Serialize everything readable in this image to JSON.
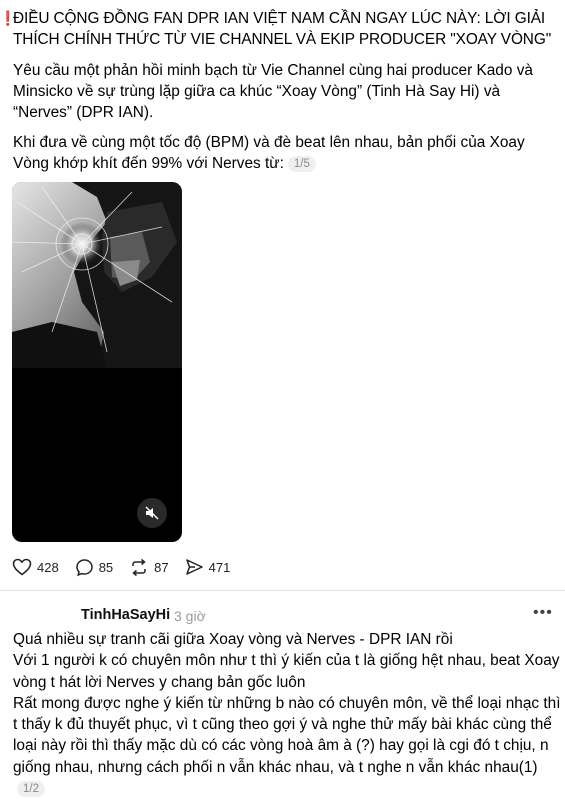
{
  "post": {
    "lead_icon": "❗",
    "title": "ĐIỀU CỘNG ĐỒNG FAN DPR IAN VIỆT NAM CẦN NGAY LÚC NÀY: LỜI GIẢI THÍCH CHÍNH THỨC TỪ VIE CHANNEL VÀ EKIP PRODUCER \"XOAY VÒNG\"",
    "para1": "Yêu cầu một phản hồi minh bạch từ Vie Channel cùng hai producer Kado và Minsicko về sự trùng lặp giữa ca khúc “Xoay Vòng” (Tinh Hà Say Hi) và “Nerves” (DPR IAN).",
    "para2": "Khi đưa về cùng một tốc độ (BPM) và đè beat lên nhau, bản phối của Xoay Vòng khớp khít đến 99% với Nerves từ:",
    "pager": "1/5",
    "media": {
      "mute_icon": "speaker-muted-icon"
    },
    "actions": {
      "likes": "428",
      "comments": "85",
      "reposts": "87",
      "shares": "471"
    }
  },
  "reply": {
    "username": "TinhHaSayHi",
    "time": "3 giờ",
    "lines": [
      "Quá nhiều sự tranh cãi giữa Xoay vòng và Nerves - DPR IAN rồi",
      "Với 1 người k có chuyên môn như t thì ý kiến của t là giống hệt nhau, beat Xoay vòng t hát lời Nerves y chang bản gốc luôn",
      "Rất mong được nghe ý kiến từ những b nào có chuyên môn, về thể loại nhạc thì t thấy k đủ thuyết phục, vì t cũng theo gợi ý và nghe thử mấy bài khác cùng thể loại này rồi thì thấy mặc dù có các vòng hoà âm à (?) hay gọi là cgi đó t chịu, n giống nhau, nhưng cách phối n vẫn khác nhau, và t nghe n vẫn khác nhau(1)"
    ],
    "pager": "1/2"
  }
}
